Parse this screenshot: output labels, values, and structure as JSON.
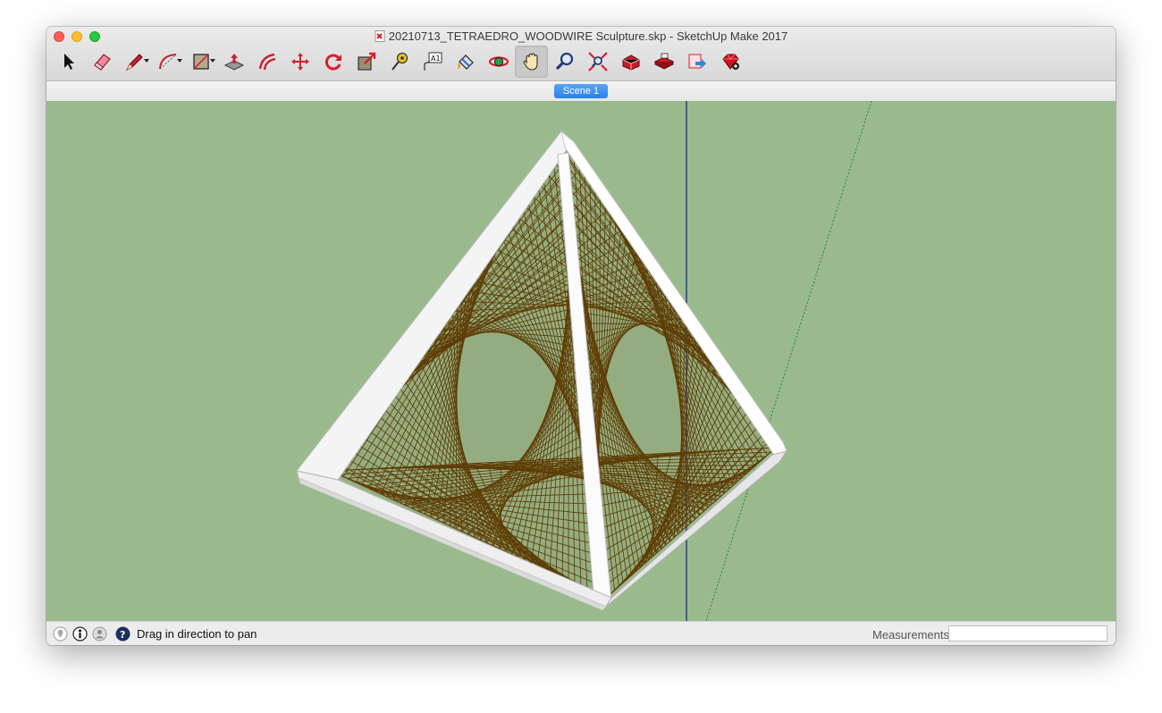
{
  "window": {
    "title": "20210713_TETRAEDRO_WOODWIRE Sculpture.skp - SketchUp Make 2017",
    "traffic_lights": [
      "close",
      "minimize",
      "zoom"
    ]
  },
  "toolbar": {
    "tools": [
      {
        "name": "select-tool",
        "icon": "arrow-icon",
        "dropdown": false
      },
      {
        "name": "eraser-tool",
        "icon": "eraser-icon",
        "dropdown": false
      },
      {
        "name": "line-tool",
        "icon": "pencil-icon",
        "dropdown": true
      },
      {
        "name": "arc-tool",
        "icon": "arc-icon",
        "dropdown": true
      },
      {
        "name": "shape-tool",
        "icon": "rectangle-icon",
        "dropdown": true
      },
      {
        "name": "push-pull-tool",
        "icon": "push-pull-icon",
        "dropdown": false
      },
      {
        "name": "offset-tool",
        "icon": "offset-icon",
        "dropdown": false
      },
      {
        "name": "move-tool",
        "icon": "move-icon",
        "dropdown": false
      },
      {
        "name": "rotate-tool",
        "icon": "rotate-icon",
        "dropdown": false
      },
      {
        "name": "scale-tool",
        "icon": "scale-icon",
        "dropdown": false
      },
      {
        "name": "tape-measure-tool",
        "icon": "tape-measure-icon",
        "dropdown": false
      },
      {
        "name": "text-tool",
        "icon": "text-icon",
        "dropdown": false
      },
      {
        "name": "paint-bucket-tool",
        "icon": "paint-bucket-icon",
        "dropdown": false
      },
      {
        "name": "orbit-tool",
        "icon": "orbit-icon",
        "dropdown": false
      },
      {
        "name": "pan-tool",
        "icon": "hand-icon",
        "dropdown": false,
        "active": true
      },
      {
        "name": "zoom-tool",
        "icon": "magnifier-icon",
        "dropdown": false
      },
      {
        "name": "zoom-extents-tool",
        "icon": "zoom-extents-icon",
        "dropdown": false
      },
      {
        "name": "warehouse-tool",
        "icon": "warehouse-icon",
        "dropdown": false
      },
      {
        "name": "extension-warehouse-tool",
        "icon": "extension-warehouse-icon",
        "dropdown": false
      },
      {
        "name": "share-model-tool",
        "icon": "share-model-icon",
        "dropdown": false
      },
      {
        "name": "extension-manager-tool",
        "icon": "ruby-icon",
        "dropdown": false
      }
    ]
  },
  "scenes": {
    "tabs": [
      {
        "label": "Scene 1",
        "active": true
      }
    ]
  },
  "viewport": {
    "background": "#9aba8e",
    "frame_color": "#ffffff",
    "wire_color": "#5e3d05"
  },
  "status": {
    "text": "Drag in direction to pan",
    "icons": [
      "geo-location-icon",
      "credits-icon",
      "user-icon",
      "help-icon"
    ]
  },
  "measurements": {
    "label": "Measurements",
    "value": ""
  }
}
